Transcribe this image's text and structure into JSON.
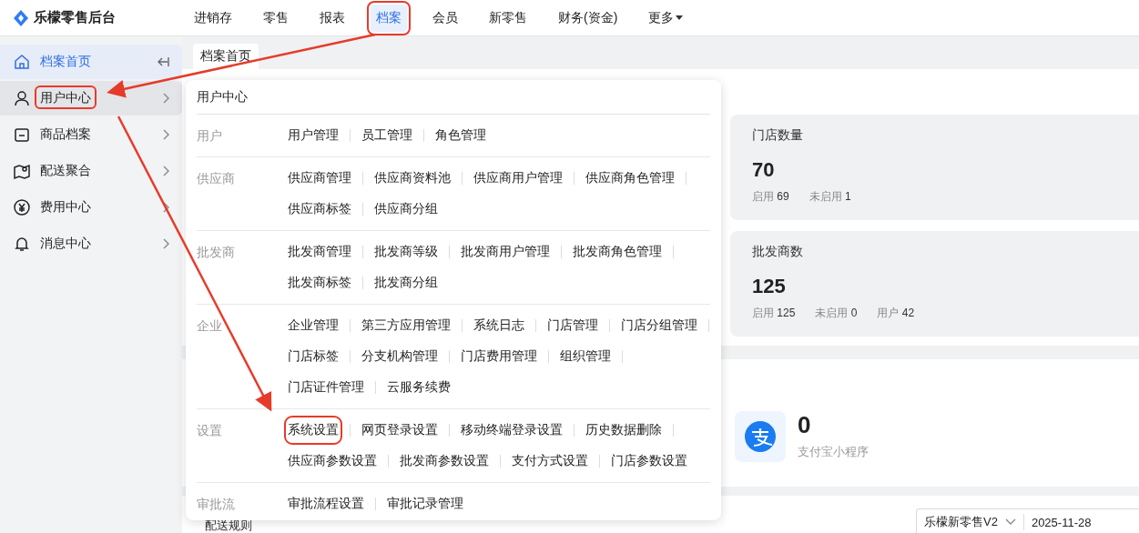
{
  "app": {
    "name": "乐檬零售后台"
  },
  "nav": [
    {
      "label": "进销存",
      "selected": false,
      "highlighted": false
    },
    {
      "label": "零售",
      "selected": false,
      "highlighted": false
    },
    {
      "label": "报表",
      "selected": false,
      "highlighted": false
    },
    {
      "label": "档案",
      "selected": true,
      "highlighted": true
    },
    {
      "label": "会员",
      "selected": false,
      "highlighted": false
    },
    {
      "label": "新零售",
      "selected": false,
      "highlighted": false
    },
    {
      "label": "财务(资金)",
      "selected": false,
      "highlighted": false
    },
    {
      "label": "更多",
      "selected": false,
      "highlighted": false,
      "kind": "dropdown"
    }
  ],
  "sidebar": {
    "items": [
      {
        "label": "档案首页",
        "selected": true,
        "hovered": false,
        "highlighted": false,
        "kind": "collapse"
      },
      {
        "label": "用户中心",
        "selected": false,
        "hovered": true,
        "highlighted": true,
        "kind": "submenu"
      },
      {
        "label": "商品档案",
        "selected": false,
        "hovered": false,
        "highlighted": false,
        "kind": "submenu"
      },
      {
        "label": "配送聚合",
        "selected": false,
        "hovered": false,
        "highlighted": false,
        "kind": "submenu"
      },
      {
        "label": "费用中心",
        "selected": false,
        "hovered": false,
        "highlighted": false,
        "kind": "submenu"
      },
      {
        "label": "消息中心",
        "selected": false,
        "hovered": false,
        "highlighted": false,
        "kind": "submenu"
      }
    ]
  },
  "tabs": [
    {
      "label": "档案首页",
      "selected": true
    }
  ],
  "stat_cards": [
    {
      "title": "门店数量",
      "value": "70",
      "stats": [
        {
          "label": "启用",
          "value": "69"
        },
        {
          "label": "未启用",
          "value": "1"
        }
      ]
    },
    {
      "title": "批发商数",
      "value": "125",
      "stats": [
        {
          "label": "启用",
          "value": "125"
        },
        {
          "label": "未启用",
          "value": "0"
        },
        {
          "label": "用户",
          "value": "42"
        }
      ]
    }
  ],
  "mini_program": {
    "value": "0",
    "label": "支付宝小程序"
  },
  "bottom": {
    "title": "配送规则",
    "select": "乐檬新零售V2",
    "date": "2025-11-28"
  },
  "menu": {
    "title": "用户中心",
    "sections": [
      {
        "label": "用户",
        "rows": [
          [
            {
              "label": "用户管理",
              "highlighted": false
            },
            {
              "label": "员工管理",
              "highlighted": false
            },
            {
              "label": "角色管理",
              "highlighted": false
            }
          ]
        ]
      },
      {
        "label": "供应商",
        "rows": [
          [
            {
              "label": "供应商管理",
              "highlighted": false
            },
            {
              "label": "供应商资料池",
              "highlighted": false
            },
            {
              "label": "供应商用户管理",
              "highlighted": false
            },
            {
              "label": "供应商角色管理",
              "highlighted": false
            }
          ],
          [
            {
              "label": "供应商标签",
              "highlighted": false
            },
            {
              "label": "供应商分组",
              "highlighted": false
            }
          ]
        ]
      },
      {
        "label": "批发商",
        "rows": [
          [
            {
              "label": "批发商管理",
              "highlighted": false
            },
            {
              "label": "批发商等级",
              "highlighted": false
            },
            {
              "label": "批发商用户管理",
              "highlighted": false
            },
            {
              "label": "批发商角色管理",
              "highlighted": false
            }
          ],
          [
            {
              "label": "批发商标签",
              "highlighted": false
            },
            {
              "label": "批发商分组",
              "highlighted": false
            }
          ]
        ]
      },
      {
        "label": "企业",
        "rows": [
          [
            {
              "label": "企业管理",
              "highlighted": false
            },
            {
              "label": "第三方应用管理",
              "highlighted": false
            },
            {
              "label": "系统日志",
              "highlighted": false
            },
            {
              "label": "门店管理",
              "highlighted": false
            },
            {
              "label": "门店分组管理",
              "highlighted": false
            }
          ],
          [
            {
              "label": "门店标签",
              "highlighted": false
            },
            {
              "label": "分支机构管理",
              "highlighted": false
            },
            {
              "label": "门店费用管理",
              "highlighted": false
            },
            {
              "label": "组织管理",
              "highlighted": false
            }
          ],
          [
            {
              "label": "门店证件管理",
              "highlighted": false
            },
            {
              "label": "云服务续费",
              "highlighted": false
            }
          ]
        ]
      },
      {
        "label": "设置",
        "rows": [
          [
            {
              "label": "系统设置",
              "highlighted": true
            },
            {
              "label": "网页登录设置",
              "highlighted": false
            },
            {
              "label": "移动终端登录设置",
              "highlighted": false
            },
            {
              "label": "历史数据删除",
              "highlighted": false
            }
          ],
          [
            {
              "label": "供应商参数设置",
              "highlighted": false
            },
            {
              "label": "批发商参数设置",
              "highlighted": false
            },
            {
              "label": "支付方式设置",
              "highlighted": false
            },
            {
              "label": "门店参数设置",
              "highlighted": false
            }
          ]
        ]
      },
      {
        "label": "审批流",
        "rows": [
          [
            {
              "label": "审批流程设置",
              "highlighted": false
            },
            {
              "label": "审批记录管理",
              "highlighted": false
            }
          ]
        ]
      }
    ]
  }
}
